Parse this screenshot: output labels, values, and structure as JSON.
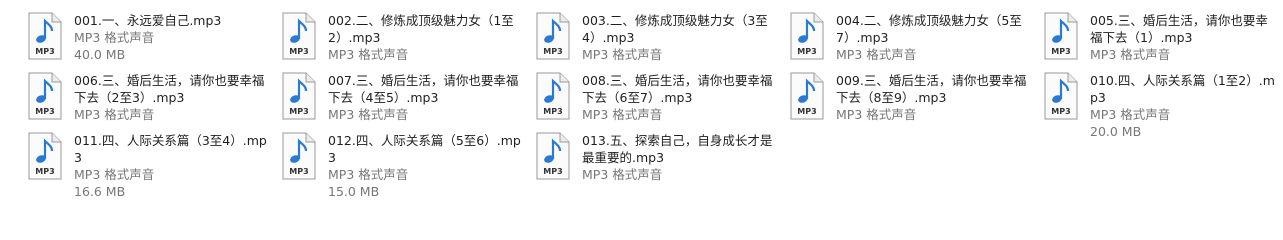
{
  "files": [
    {
      "name": "001.一、永远爱自己.mp3",
      "type": "MP3 格式声音",
      "size": "40.0 MB"
    },
    {
      "name": "002.二、修炼成顶级魅力女（1至2）.mp3",
      "type": "MP3 格式声音",
      "size": ""
    },
    {
      "name": "003.二、修炼成顶级魅力女（3至4）.mp3",
      "type": "MP3 格式声音",
      "size": ""
    },
    {
      "name": "004.二、修炼成顶级魅力女（5至7）.mp3",
      "type": "MP3 格式声音",
      "size": ""
    },
    {
      "name": "005.三、婚后生活，请你也要幸福下去（1）.mp3",
      "type": "MP3 格式声音",
      "size": ""
    },
    {
      "name": "006.三、婚后生活，请你也要幸福下去（2至3）.mp3",
      "type": "MP3 格式声音",
      "size": ""
    },
    {
      "name": "007.三、婚后生活，请你也要幸福下去（4至5）.mp3",
      "type": "MP3 格式声音",
      "size": ""
    },
    {
      "name": "008.三、婚后生活，请你也要幸福下去（6至7）.mp3",
      "type": "MP3 格式声音",
      "size": ""
    },
    {
      "name": "009.三、婚后生活，请你也要幸福下去（8至9）.mp3",
      "type": "MP3 格式声音",
      "size": ""
    },
    {
      "name": "010.四、人际关系篇（1至2）.mp3",
      "type": "MP3 格式声音",
      "size": "20.0 MB"
    },
    {
      "name": "011.四、人际关系篇（3至4）.mp3",
      "type": "MP3 格式声音",
      "size": "16.6 MB"
    },
    {
      "name": "012.四、人际关系篇（5至6）.mp3",
      "type": "MP3 格式声音",
      "size": "15.0 MB"
    },
    {
      "name": "013.五、探索自己，自身成长才是最重要的.mp3",
      "type": "MP3 格式声音",
      "size": ""
    }
  ],
  "icon": {
    "label": "MP3",
    "name": "mp3-audio-file-icon",
    "accent": "#2a79d3"
  }
}
